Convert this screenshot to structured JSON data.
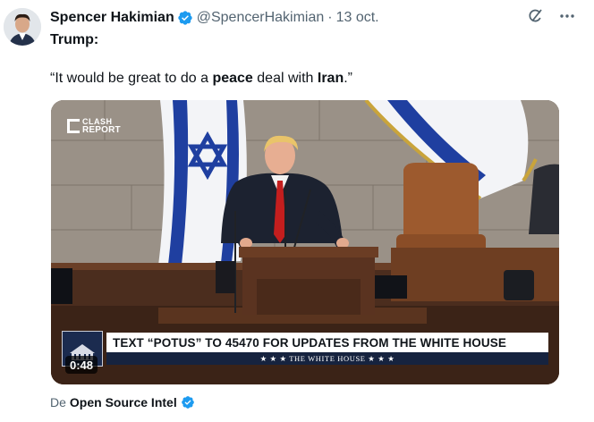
{
  "tweet": {
    "author_name": "Spencer Hakimian",
    "handle": "@SpencerHakimian",
    "separator": "·",
    "date": "13 oct.",
    "text_line1": "Trump:",
    "text_open": "“It would be great to do a ",
    "text_bold1": "peace",
    "text_mid": " deal with ",
    "text_bold2": "Iran",
    "text_close": ".”"
  },
  "media": {
    "brand_top": "CLASH",
    "brand_bottom": "REPORT",
    "chyron_main": "TEXT “POTUS” TO 45470 FOR UPDATES FROM THE WHITE HOUSE",
    "chyron_sub": "★ ★ ★   THE WHITE HOUSE   ★ ★ ★",
    "duration": "0:48"
  },
  "source": {
    "prefix": "De",
    "name": "Open Source Intel"
  },
  "icons": {
    "verified": "verified-badge-icon",
    "grok": "grok-icon",
    "more": "more-dots-icon"
  },
  "colors": {
    "verified_blue": "#1d9bf0",
    "secondary_text": "#536471",
    "chyron_navy": "#16233f",
    "flag_blue": "#1f3fa0"
  }
}
